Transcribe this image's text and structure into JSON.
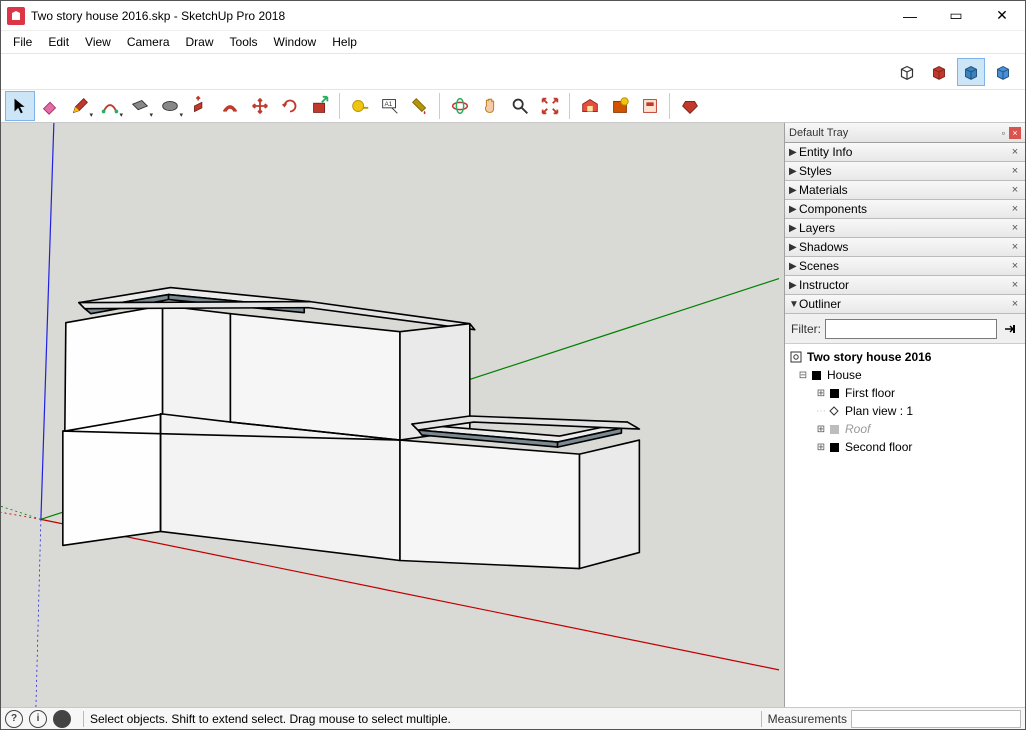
{
  "window": {
    "title": "Two story house 2016.skp - SketchUp Pro 2018",
    "controls": {
      "minimize": "—",
      "maximize": "▭",
      "close": "✕"
    }
  },
  "menu": [
    "File",
    "Edit",
    "View",
    "Camera",
    "Draw",
    "Tools",
    "Window",
    "Help"
  ],
  "view_modes": [
    {
      "name": "wireframe-icon",
      "active": false
    },
    {
      "name": "shaded-red-icon",
      "active": false
    },
    {
      "name": "shaded-blue-icon",
      "active": true
    },
    {
      "name": "shaded-blue2-icon",
      "active": false
    }
  ],
  "tools": [
    {
      "name": "select-tool",
      "active": true,
      "dropdown": false
    },
    {
      "name": "eraser-tool",
      "dropdown": false
    },
    {
      "name": "pencil-tool",
      "dropdown": true
    },
    {
      "name": "arc-tool",
      "dropdown": true
    },
    {
      "name": "rectangle-tool",
      "dropdown": true
    },
    {
      "name": "circle-tool",
      "dropdown": true
    },
    {
      "name": "pushpull-tool",
      "dropdown": false
    },
    {
      "name": "offset-tool",
      "dropdown": false
    },
    {
      "name": "move-tool",
      "dropdown": false
    },
    {
      "name": "rotate-tool",
      "dropdown": false
    },
    {
      "name": "scale-tool",
      "dropdown": false
    },
    {
      "sep": true
    },
    {
      "name": "tape-tool",
      "dropdown": false
    },
    {
      "name": "text-tool",
      "dropdown": false
    },
    {
      "name": "paint-tool",
      "dropdown": false
    },
    {
      "sep": true
    },
    {
      "name": "orbit-tool",
      "dropdown": false
    },
    {
      "name": "pan-tool",
      "dropdown": false
    },
    {
      "name": "zoom-tool",
      "dropdown": false
    },
    {
      "name": "zoom-extents-tool",
      "dropdown": false
    },
    {
      "sep": true
    },
    {
      "name": "warehouse-tool",
      "dropdown": false
    },
    {
      "name": "extensions-tool",
      "dropdown": false
    },
    {
      "name": "layout-tool",
      "dropdown": false
    },
    {
      "sep": true
    },
    {
      "name": "ruby-tool",
      "dropdown": false
    }
  ],
  "tray": {
    "title": "Default Tray",
    "panels": [
      {
        "label": "Entity Info",
        "expanded": false
      },
      {
        "label": "Styles",
        "expanded": false
      },
      {
        "label": "Materials",
        "expanded": false
      },
      {
        "label": "Components",
        "expanded": false
      },
      {
        "label": "Layers",
        "expanded": false
      },
      {
        "label": "Shadows",
        "expanded": false
      },
      {
        "label": "Scenes",
        "expanded": false
      },
      {
        "label": "Instructor",
        "expanded": false
      },
      {
        "label": "Outliner",
        "expanded": true
      }
    ],
    "outliner": {
      "filter_label": "Filter:",
      "filter_value": "",
      "root": "Two story house 2016",
      "items": [
        {
          "indent": 1,
          "tw": "⊟",
          "icon": "solid",
          "label": "House",
          "bold": false
        },
        {
          "indent": 2,
          "tw": "⊞",
          "icon": "solid",
          "label": "First floor"
        },
        {
          "indent": 2,
          "tw": "·",
          "icon": "diamond",
          "label": "Plan view : 1"
        },
        {
          "indent": 2,
          "tw": "⊞",
          "icon": "solid",
          "label": "Roof",
          "dim": true
        },
        {
          "indent": 2,
          "tw": "⊞",
          "icon": "solid",
          "label": "Second floor"
        }
      ]
    }
  },
  "status": {
    "hint": "Select objects. Shift to extend select. Drag mouse to select multiple.",
    "measurements_label": "Measurements",
    "measurements_value": "",
    "icons": [
      "?",
      "i",
      "●"
    ]
  }
}
